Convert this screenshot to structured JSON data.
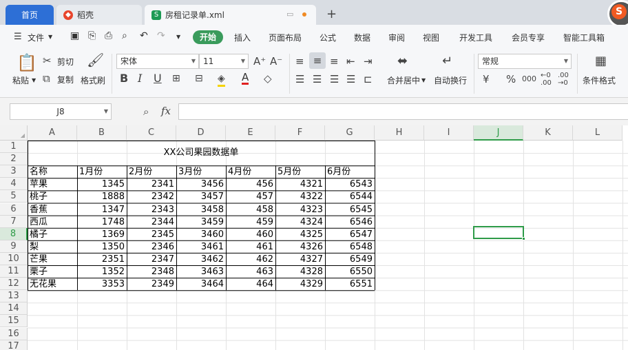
{
  "tabs": {
    "home": "首页",
    "docer": "稻壳",
    "file": "房租记录单.xml",
    "new_tab": "+"
  },
  "menu": {
    "file": "文件",
    "items": [
      "开始",
      "插入",
      "页面布局",
      "公式",
      "数据",
      "审阅",
      "视图",
      "开发工具",
      "会员专享",
      "智能工具箱"
    ]
  },
  "ribbon": {
    "paste": "粘贴",
    "cut": "剪切",
    "copy": "复制",
    "format_painter": "格式刷",
    "font_name": "宋体",
    "font_size": "11",
    "bold": "B",
    "italic": "I",
    "underline": "U",
    "merge_center": "合并居中",
    "wrap_text": "自动换行",
    "number_format": "常规",
    "currency": "¥",
    "percent": "%",
    "thousands": "000",
    "conditional_format": "条件格式"
  },
  "formula_bar": {
    "name_box": "J8",
    "fx": "fx",
    "content": ""
  },
  "columns": [
    "A",
    "B",
    "C",
    "D",
    "E",
    "F",
    "G",
    "H",
    "I",
    "J",
    "K",
    "L"
  ],
  "rows": [
    "1",
    "2",
    "3",
    "4",
    "5",
    "6",
    "7",
    "8",
    "9",
    "10",
    "11",
    "12",
    "13",
    "14",
    "15",
    "16",
    "17"
  ],
  "sheet": {
    "title": "XX公司果园数据单",
    "headers": [
      "名称",
      "1月份",
      "2月份",
      "3月份",
      "4月份",
      "5月份",
      "6月份"
    ],
    "data": [
      [
        "苹果",
        "1345",
        "2341",
        "3456",
        "456",
        "4321",
        "6543"
      ],
      [
        "桃子",
        "1888",
        "2342",
        "3457",
        "457",
        "4322",
        "6544"
      ],
      [
        "香蕉",
        "1347",
        "2343",
        "3458",
        "458",
        "4323",
        "6545"
      ],
      [
        "西瓜",
        "1748",
        "2344",
        "3459",
        "459",
        "4324",
        "6546"
      ],
      [
        "橘子",
        "1369",
        "2345",
        "3460",
        "460",
        "4325",
        "6547"
      ],
      [
        "梨",
        "1350",
        "2346",
        "3461",
        "461",
        "4326",
        "6548"
      ],
      [
        "芒果",
        "2351",
        "2347",
        "3462",
        "462",
        "4327",
        "6549"
      ],
      [
        "栗子",
        "1352",
        "2348",
        "3463",
        "463",
        "4328",
        "6550"
      ],
      [
        "无花果",
        "3353",
        "2349",
        "3464",
        "464",
        "4329",
        "6551"
      ]
    ]
  },
  "colors": {
    "accent_green": "#3a9b5c",
    "tab_blue": "#2d6fd6",
    "selection": "#2e9b48"
  }
}
